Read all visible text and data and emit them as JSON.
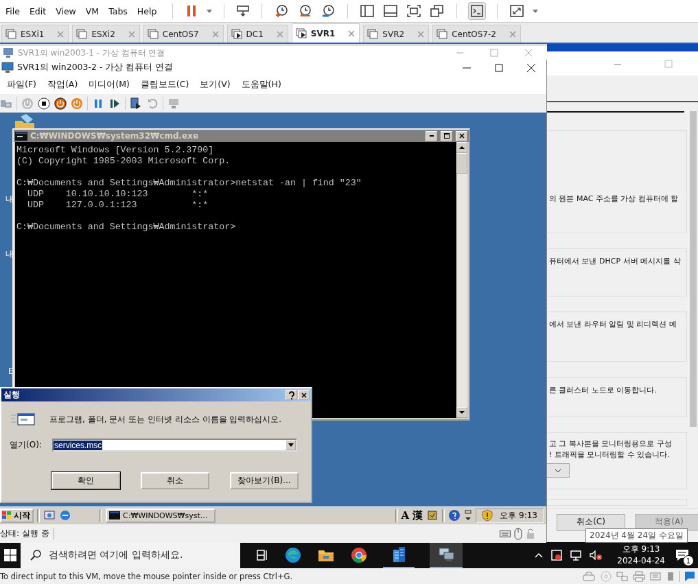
{
  "menu": [
    "File",
    "Edit",
    "View",
    "VM",
    "Tabs",
    "Help"
  ],
  "tabs": [
    {
      "label": "ESXi1",
      "selected": false,
      "running": false
    },
    {
      "label": "ESXi2",
      "selected": false,
      "running": false
    },
    {
      "label": "CentOS7",
      "selected": false,
      "running": false
    },
    {
      "label": "DC1",
      "selected": false,
      "running": true
    },
    {
      "label": "SVR1",
      "selected": true,
      "running": true
    },
    {
      "label": "SVR2",
      "selected": false,
      "running": false
    },
    {
      "label": "CentOS7-2",
      "selected": false,
      "running": false
    }
  ],
  "back_window": {
    "title": "SVR1의 win2003-1 - 가상 컴퓨터 연결"
  },
  "vm_window": {
    "title": "SVR1의 win2003-2 - 가상 컴퓨터 연결",
    "menu": [
      "파일(F)",
      "작업(A)",
      "미디어(M)",
      "클립보드(C)",
      "보기(V)",
      "도움말(H)"
    ],
    "status": "상태: 실행 중"
  },
  "desktop_labels": [
    "내",
    "내",
    "E"
  ],
  "cmd": {
    "title": "C:₩WINDOWS₩system32₩cmd.exe",
    "blocks": [
      [
        "Microsoft Windows [Version 5.2.3790]",
        "(C) Copyright 1985-2003 Microsoft Corp."
      ],
      [
        "C:₩Documents and Settings₩Administrator>netstat -an | find \"23\"",
        "  UDP    10.10.10.10:123        *:*",
        "  UDP    127.0.0.1:123          *:*"
      ],
      [
        "C:₩Documents and Settings₩Administrator>"
      ]
    ]
  },
  "run_dialog": {
    "title": "실행",
    "prompt": "프로그램, 폴더, 문서 또는 인터넷 리소스 이름을 입력하십시오.",
    "open_label": "열기(O):",
    "value": "services.msc",
    "buttons": [
      "확인",
      "취소",
      "찾아보기(B)..."
    ]
  },
  "guest_taskbar": {
    "start": "시작",
    "task": "C:₩WINDOWS₩syst...",
    "ime": [
      "A",
      "漢"
    ],
    "clock": "오후 9:13"
  },
  "settings_panel": {
    "cards": [
      [
        "의 원본 MAC 주소를 가상 컴퓨터에 할"
      ],
      [
        "퓨터에서 보낸 DHCP 서버 메시지를 삭"
      ],
      [
        "에서 보낸 라우터 알림 및 리디렉션 메"
      ],
      [
        "른 클러스터 노드로 이동합니다."
      ],
      [
        "고 그 복사본을 모니터링용으로 구성",
        "! 트래픽을 모니터링할 수 있습니다."
      ]
    ],
    "buttons": [
      {
        "label": "취소(C)",
        "disabled": false
      },
      {
        "label": "적용(A)",
        "disabled": true
      }
    ]
  },
  "tooltip": "2024년 4월 24일 수요일",
  "host_taskbar": {
    "search_placeholder": "검색하려면 여기에 입력하세요.",
    "time": "오후 9:13",
    "date": "2024-04-24",
    "notifications": "1"
  },
  "status_bar": "To direct input to this VM, move the mouse pointer inside or press Ctrl+G."
}
